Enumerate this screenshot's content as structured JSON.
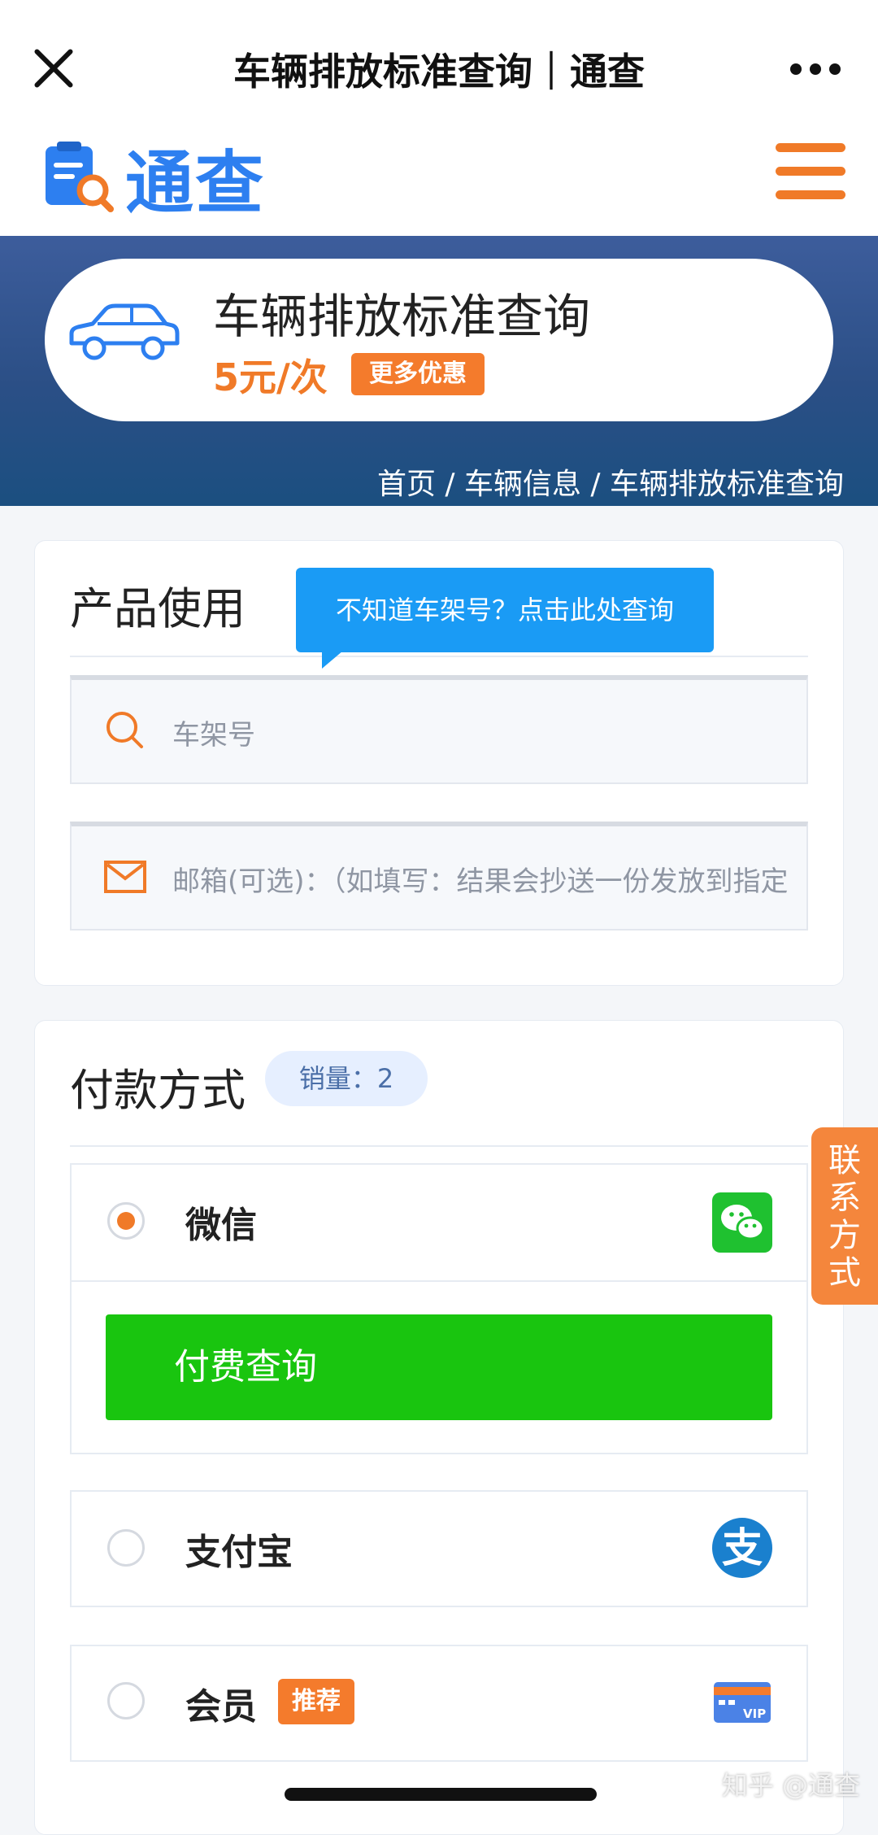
{
  "nav": {
    "title": "车辆排放标准查询｜通查"
  },
  "brand": {
    "name": "通查"
  },
  "banner": {
    "title": "车辆排放标准查询",
    "price": "5元/次",
    "promo": "更多优惠",
    "breadcrumb": "首页 / 车辆信息 / 车辆排放标准查询"
  },
  "product": {
    "title": "产品使用",
    "tooltip": "不知道车架号？点击此处查询",
    "vin_placeholder": "车架号",
    "email_placeholder": "邮箱(可选)：（如填写：结果会抄送一份发放到指定"
  },
  "payment": {
    "title": "付款方式",
    "sales": "销量：2",
    "methods": [
      {
        "label": "微信",
        "selected": true,
        "icon": "wechat-icon"
      },
      {
        "label": "支付宝",
        "selected": false,
        "icon": "alipay-icon"
      },
      {
        "label": "会员",
        "selected": false,
        "icon": "vip-card-icon",
        "badge": "推荐"
      }
    ],
    "pay_button": "付费查询",
    "alipay_glyph": "支",
    "vip_text": "VIP"
  },
  "contact": {
    "label": "联系方式"
  },
  "watermark": "知乎 @通查",
  "colors": {
    "accent": "#f07a28",
    "brand": "#2d7ff0",
    "wechat": "#19c50f",
    "tooltip": "#1a9bf5"
  }
}
